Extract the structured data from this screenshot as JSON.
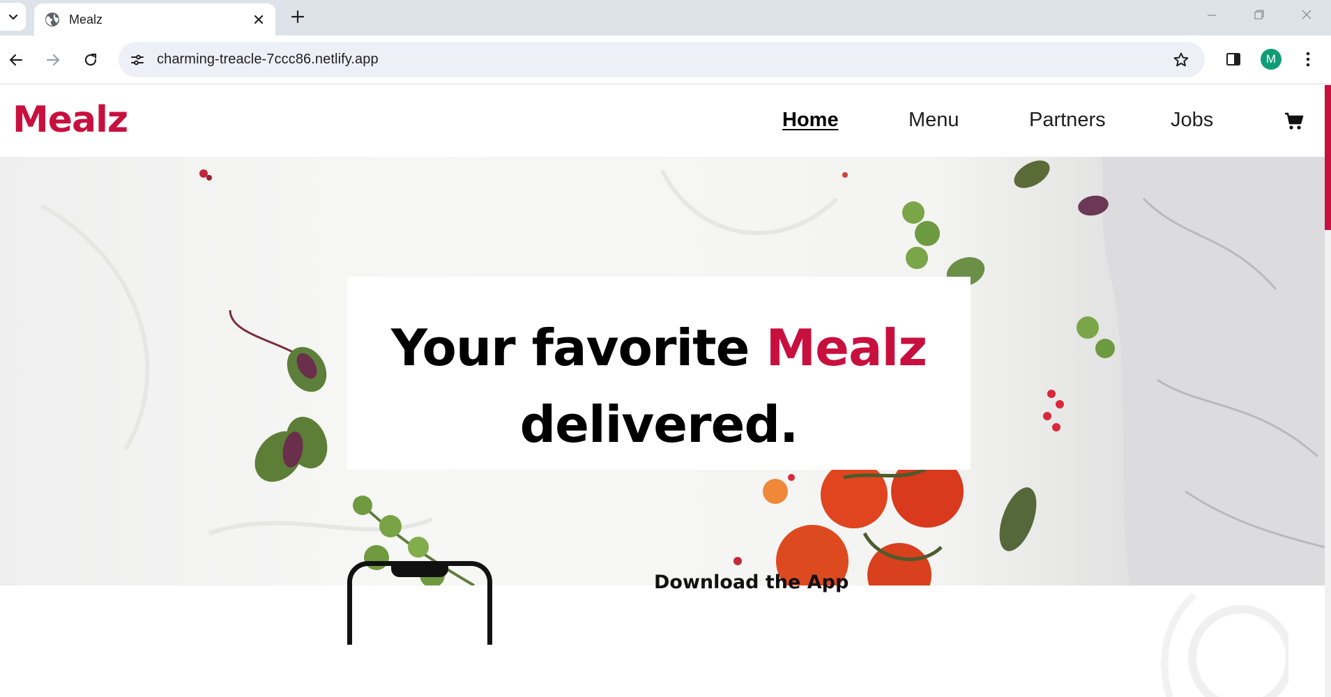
{
  "browser": {
    "tab_title": "Mealz",
    "url": "charming-treacle-7ccc86.netlify.app",
    "profile_initial": "M"
  },
  "site": {
    "logo": "Mealz",
    "nav": [
      "Home",
      "Menu",
      "Partners",
      "Jobs"
    ],
    "active_nav": "Home",
    "hero": {
      "line1_prefix": "Your favorite ",
      "line1_brand": "Mealz",
      "line2": "delivered."
    },
    "download_title": "Download the App",
    "colors": {
      "brand": "#c8103f",
      "text": "#000000"
    },
    "icons": [
      "cart-icon"
    ]
  }
}
